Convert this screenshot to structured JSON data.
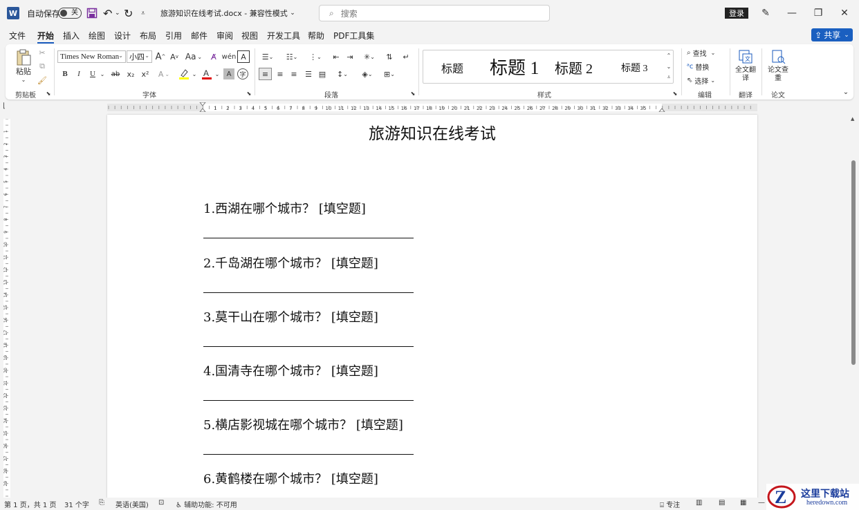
{
  "titlebar": {
    "autosave_label": "自动保存",
    "autosave_state": "关",
    "filename": "旅游知识在线考试.docx",
    "separator": "-",
    "mode": "兼容性模式",
    "search_placeholder": "搜索",
    "login": "登录"
  },
  "menu": {
    "tabs": [
      "文件",
      "开始",
      "插入",
      "绘图",
      "设计",
      "布局",
      "引用",
      "邮件",
      "审阅",
      "视图",
      "开发工具",
      "帮助",
      "PDF工具集"
    ],
    "active": "开始",
    "share": "共享"
  },
  "ribbon": {
    "clipboard": {
      "paste": "粘贴",
      "label": "剪贴板"
    },
    "font": {
      "name": "Times New Roman",
      "size": "小四",
      "label": "字体",
      "bold": "B",
      "italic": "I",
      "underline": "U",
      "strike": "ab",
      "subscript": "x₂",
      "superscript": "x²",
      "grow": "A",
      "shrink": "A",
      "case": "Aa"
    },
    "paragraph": {
      "label": "段落"
    },
    "styles": {
      "label": "样式",
      "items": [
        "标题",
        "标题 1",
        "标题 2",
        "标题 3"
      ]
    },
    "editing": {
      "find": "查找",
      "replace": "替换",
      "select": "选择",
      "label": "编辑"
    },
    "translate": {
      "button": "全文翻译",
      "label": "翻译"
    },
    "paper": {
      "button": "论文查重",
      "label": "论文"
    }
  },
  "colors": {
    "accent": "#185abd",
    "highlight": "#ffff00",
    "font_color": "#e00000",
    "share_bg": "#1a5fc0"
  },
  "document": {
    "title": "旅游知识在线考试",
    "questions": [
      "1.西湖在哪个城市？ [填空题]",
      "2.千岛湖在哪个城市？ [填空题]",
      "3.莫干山在哪个城市？ [填空题]",
      "4.国清寺在哪个城市？ [填空题]",
      "5.横店影视城在哪个城市？ [填空题]",
      "6.黄鹤楼在哪个城市？ [填空题]"
    ]
  },
  "ruler": {
    "numbers": [
      "1",
      "2",
      "3",
      "4",
      "5",
      "6",
      "7",
      "8",
      "9",
      "10",
      "11",
      "12",
      "13",
      "14",
      "15",
      "16",
      "17",
      "18",
      "19",
      "20",
      "21",
      "22",
      "23",
      "24",
      "25",
      "26",
      "27",
      "28",
      "29",
      "30",
      "31",
      "32",
      "33",
      "34",
      "35"
    ]
  },
  "statusbar": {
    "page": "第 1 页，共 1 页",
    "words": "31 个字",
    "language": "英语(美国)",
    "accessibility": "辅助功能: 不可用",
    "focus": "专注"
  },
  "watermark": {
    "text": "这里下载站",
    "url": "heredown.com"
  }
}
